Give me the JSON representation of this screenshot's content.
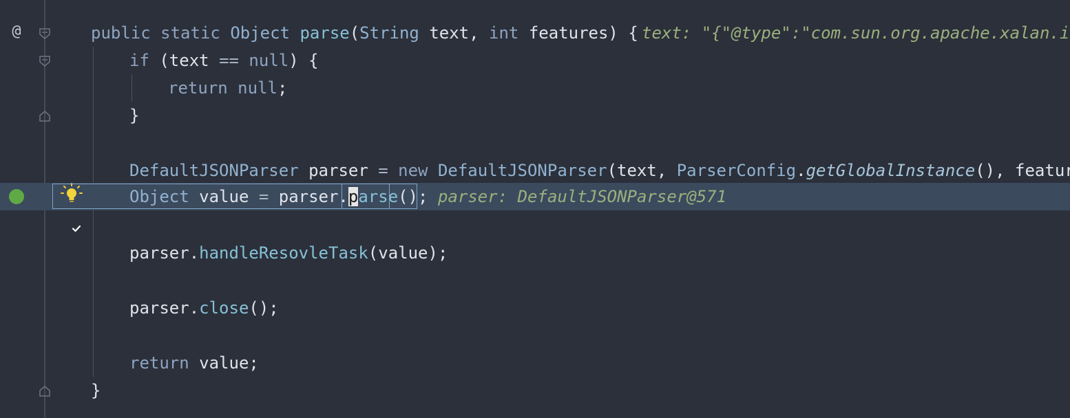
{
  "editor": {
    "gutter": {
      "override_marker": "@"
    },
    "lines": {
      "l1": {
        "kw1": "public",
        "kw2": "static",
        "ret": "Object",
        "name": "parse",
        "p_open": "(",
        "t1": "String",
        "a1": " text,",
        "t2": "int",
        "a2": " features) {",
        "hint": "text: \"{\"@type\":\"com.sun.org.apache.xalan.int"
      },
      "l2": {
        "kw": "if",
        "rest1": " (text ",
        "op": "==",
        "sp": " ",
        "null": "null",
        "rest2": ") {"
      },
      "l3": {
        "kw": "return",
        "null": " null",
        "rest": ";"
      },
      "l4": {
        "brace": "}"
      },
      "l6": {
        "type": "DefaultJSONParser",
        "var": " parser ",
        "op": "=",
        "kw": " new ",
        "ctor": "DefaultJSONParser",
        "args1": "(text, ",
        "cls": "ParserConfig",
        "dot": ".",
        "method": "getGlobalInstance",
        "args2": "(), features);"
      },
      "l7": {
        "type": "Object",
        "var": " value ",
        "op": "=",
        "obj": " parser.",
        "caret_char": "p",
        "method_rest": "arse",
        "end": "();",
        "hint": "parser: DefaultJSONParser@571"
      },
      "l9": {
        "obj": "parser.",
        "method": "handleResovleTask",
        "args": "(value);"
      },
      "l11": {
        "obj": "parser.",
        "method": "close",
        "args": "();"
      },
      "l13": {
        "kw": "return",
        "rest": " value;"
      },
      "l14": {
        "brace": "}"
      }
    },
    "icons": {
      "breakpoint_verified": "check-circle-icon",
      "intention": "light-bulb-icon",
      "fold": "fold-marker-icon"
    },
    "colors": {
      "background": "#2b303b",
      "current_line": "#3c4a5e",
      "hint": "#9bb07d",
      "breakpoint": "#5faa45",
      "bulb": "#f2d33b"
    }
  }
}
